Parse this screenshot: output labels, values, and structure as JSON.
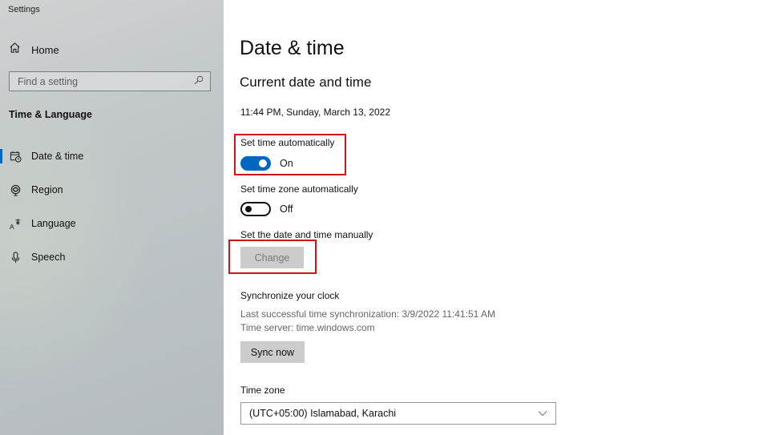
{
  "window": {
    "title": "Settings"
  },
  "sidebar": {
    "home_label": "Home",
    "search_placeholder": "Find a setting",
    "section_title": "Time & Language",
    "items": [
      {
        "label": "Date & time",
        "icon": "calendar-clock-icon",
        "active": true
      },
      {
        "label": "Region",
        "icon": "globe-icon",
        "active": false
      },
      {
        "label": "Language",
        "icon": "language-icon",
        "active": false
      },
      {
        "label": "Speech",
        "icon": "microphone-icon",
        "active": false
      }
    ]
  },
  "main": {
    "title": "Date & time",
    "subtitle": "Current date and time",
    "current_datetime": "11:44 PM, Sunday, March 13, 2022",
    "set_time_auto": {
      "label": "Set time automatically",
      "state": "On",
      "on": true
    },
    "set_timezone_auto": {
      "label": "Set time zone automatically",
      "state": "Off",
      "on": false
    },
    "manual": {
      "label": "Set the date and time manually",
      "button": "Change",
      "enabled": false
    },
    "sync": {
      "title": "Synchronize your clock",
      "last_sync": "Last successful time synchronization: 3/9/2022 11:41:51 AM",
      "server": "Time server: time.windows.com",
      "button": "Sync now"
    },
    "timezone": {
      "label": "Time zone",
      "value": "(UTC+05:00) Islamabad, Karachi"
    }
  },
  "colors": {
    "accent": "#0067c0",
    "highlight": "#d0141c"
  }
}
